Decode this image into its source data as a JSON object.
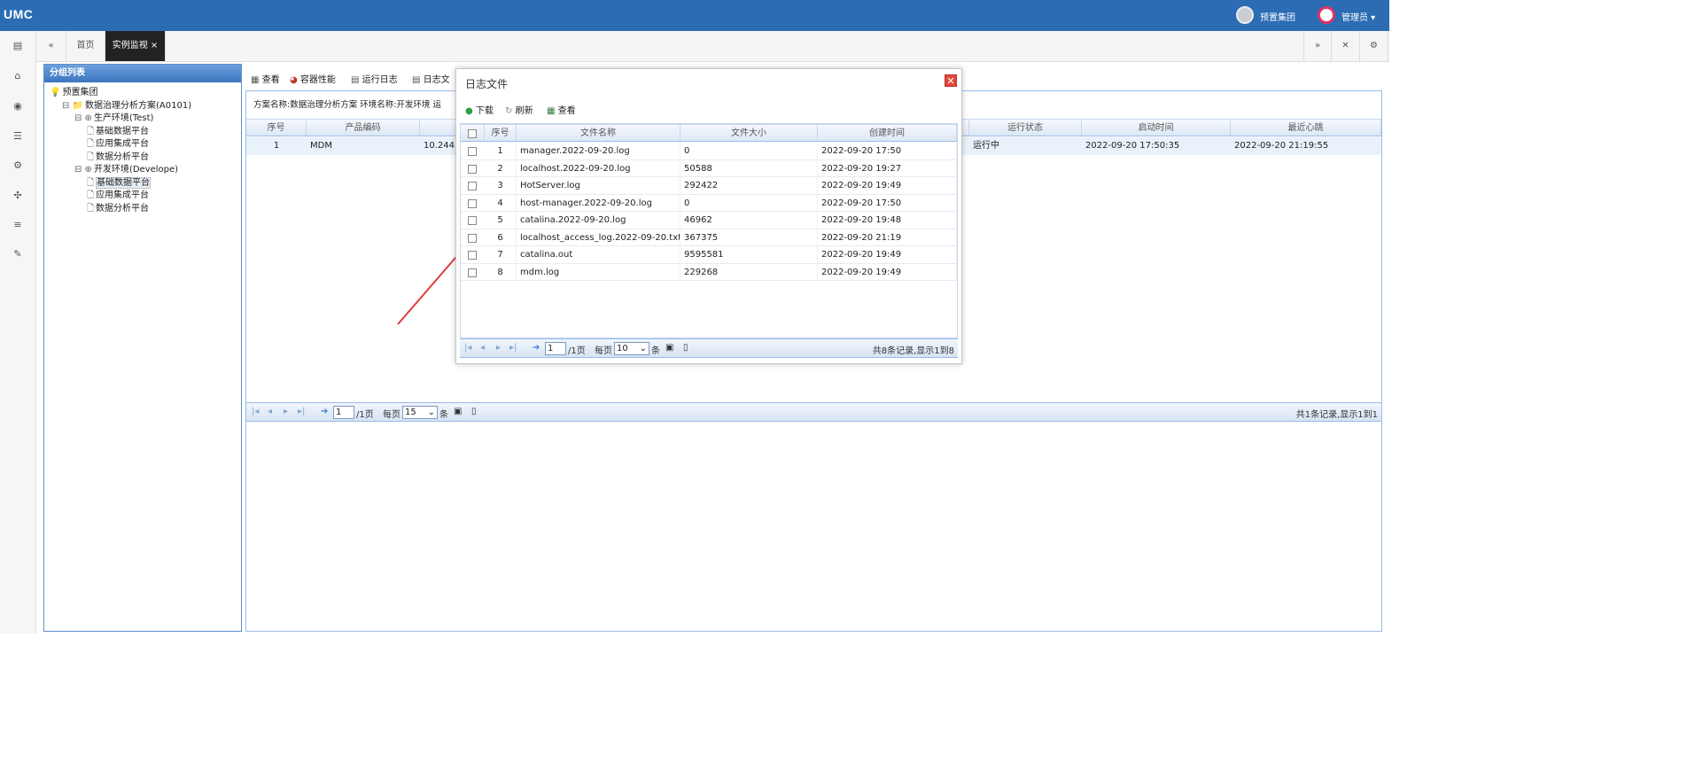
{
  "app": {
    "logo": "UMC",
    "org": "预置集团",
    "user": "管理员 ▾"
  },
  "tabs": {
    "home": "首页",
    "active": "实例监视 ×"
  },
  "sidebar_icons": [
    "dashboard-icon",
    "bank-icon",
    "eye-icon",
    "list-icon",
    "gear-icon",
    "puzzle-icon",
    "menu-icon",
    "wrench-icon"
  ],
  "group_panel": {
    "title": "分组列表",
    "tree": [
      {
        "label": "预置集团",
        "indent": 0,
        "prefix": "💡"
      },
      {
        "label": "数据治理分析方案(A0101)",
        "indent": 1,
        "prefix": "⊟ 📁"
      },
      {
        "label": "生产环境(Test)",
        "indent": 2,
        "prefix": "⊟ ⊕"
      },
      {
        "label": "基础数据平台",
        "indent": 3,
        "prefix": "🗋"
      },
      {
        "label": "应用集成平台",
        "indent": 3,
        "prefix": "🗋"
      },
      {
        "label": "数据分析平台",
        "indent": 3,
        "prefix": "🗋"
      },
      {
        "label": "开发环境(Develope)",
        "indent": 2,
        "prefix": "⊟ ⊕"
      },
      {
        "label": "基础数据平台",
        "indent": 3,
        "prefix": "🗋",
        "selected": true
      },
      {
        "label": "应用集成平台",
        "indent": 3,
        "prefix": "🗋"
      },
      {
        "label": "数据分析平台",
        "indent": 3,
        "prefix": "🗋"
      }
    ]
  },
  "toolbar": {
    "view": "查看",
    "perf": "容器性能",
    "runlog": "运行日志",
    "logfile": "日志文"
  },
  "info": "方案名称:数据治理分析方案  环境名称:开发环境  运",
  "main_grid": {
    "headers": {
      "seq": "序号",
      "code": "产品编码",
      "status": "运行状态",
      "start": "启动时间",
      "heartbeat": "最近心跳"
    },
    "row": {
      "seq": "1",
      "code": "MDM",
      "ip": "10.244.",
      "status": "运行中",
      "start": "2022-09-20 17:50:35",
      "heartbeat": "2022-09-20 21:19:55"
    },
    "pager": {
      "page": "1",
      "total_pages": "/1页",
      "per_page_label": "每页",
      "per_page": "15",
      "unit": "条",
      "summary": "共1条记录,显示1到1"
    }
  },
  "dialog": {
    "title": "日志文件",
    "close": "✕",
    "toolbar": {
      "download": "下载",
      "refresh": "刷新",
      "view": "查看"
    },
    "headers": {
      "seq": "序号",
      "name": "文件名称",
      "size": "文件大小",
      "created": "创建时间"
    },
    "rows": [
      {
        "seq": "1",
        "name": "manager.2022-09-20.log",
        "size": "0",
        "created": "2022-09-20 17:50"
      },
      {
        "seq": "2",
        "name": "localhost.2022-09-20.log",
        "size": "50588",
        "created": "2022-09-20 19:27"
      },
      {
        "seq": "3",
        "name": "HotServer.log",
        "size": "292422",
        "created": "2022-09-20 19:49"
      },
      {
        "seq": "4",
        "name": "host-manager.2022-09-20.log",
        "size": "0",
        "created": "2022-09-20 17:50"
      },
      {
        "seq": "5",
        "name": "catalina.2022-09-20.log",
        "size": "46962",
        "created": "2022-09-20 19:48"
      },
      {
        "seq": "6",
        "name": "localhost_access_log.2022-09-20.txt",
        "size": "367375",
        "created": "2022-09-20 21:19"
      },
      {
        "seq": "7",
        "name": "catalina.out",
        "size": "9595581",
        "created": "2022-09-20 19:49"
      },
      {
        "seq": "8",
        "name": "mdm.log",
        "size": "229268",
        "created": "2022-09-20 19:49"
      }
    ],
    "pager": {
      "page": "1",
      "total_pages": "/1页",
      "per_page_label": "每页",
      "per_page": "10",
      "unit": "条",
      "summary": "共8条记录,显示1到8"
    }
  },
  "colors": {
    "topbar": "#2b6cb4",
    "arrow": "#e0393e"
  }
}
